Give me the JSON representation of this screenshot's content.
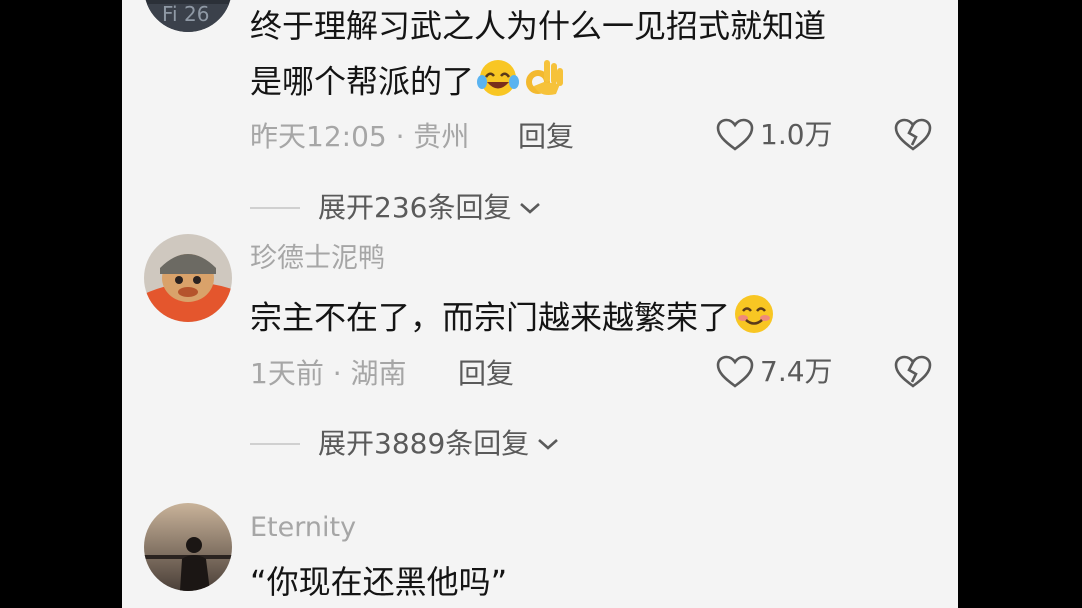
{
  "comments": [
    {
      "username": "",
      "avatar_badge": "Fi 26",
      "text": "终于理解习武之人为什么一见招式就知道",
      "text_line2": "是哪个帮派的了",
      "emojis": [
        "laughing-crying-emoji",
        "ok-hand-emoji"
      ],
      "time": "昨天12:05 · 贵州",
      "reply_label": "回复",
      "likes": "1.0万",
      "expand_label": "展开236条回复"
    },
    {
      "username": "珍德士泥鸭",
      "text": "宗主不在了，而宗门越来越繁荣了",
      "emojis": [
        "smiling-emoji"
      ],
      "time": "1天前 · 湖南",
      "reply_label": "回复",
      "likes": "7.4万",
      "expand_label": "展开3889条回复"
    },
    {
      "username": "Eternity",
      "text": "“你现在还黑他吗”"
    }
  ],
  "colors": {
    "background": "#f4f4f4",
    "text_primary": "#141414",
    "text_secondary": "#a6a6a6",
    "action_text": "#5a5a5a"
  }
}
